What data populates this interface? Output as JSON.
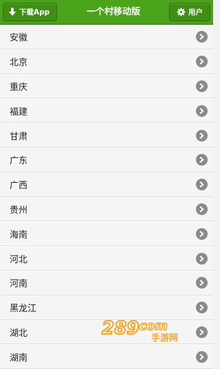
{
  "header": {
    "download_label": "下载App",
    "title": "一个村移动版",
    "user_label": "用户"
  },
  "regions": [
    {
      "label": "安徽"
    },
    {
      "label": "北京"
    },
    {
      "label": "重庆"
    },
    {
      "label": "福建"
    },
    {
      "label": "甘肃"
    },
    {
      "label": "广东"
    },
    {
      "label": "广西"
    },
    {
      "label": "贵州"
    },
    {
      "label": "海南"
    },
    {
      "label": "河北"
    },
    {
      "label": "河南"
    },
    {
      "label": "黑龙江"
    },
    {
      "label": "湖北"
    },
    {
      "label": "湖南"
    }
  ],
  "watermark": {
    "number": "289",
    "domain": "com",
    "site": "手游网"
  },
  "colors": {
    "header_bg": "#4aa31b",
    "arrow_bg": "#8a8a8a"
  },
  "icons": {
    "download": "download-arrow-icon",
    "user": "gear-icon",
    "row": "chevron-right-circle-icon"
  }
}
